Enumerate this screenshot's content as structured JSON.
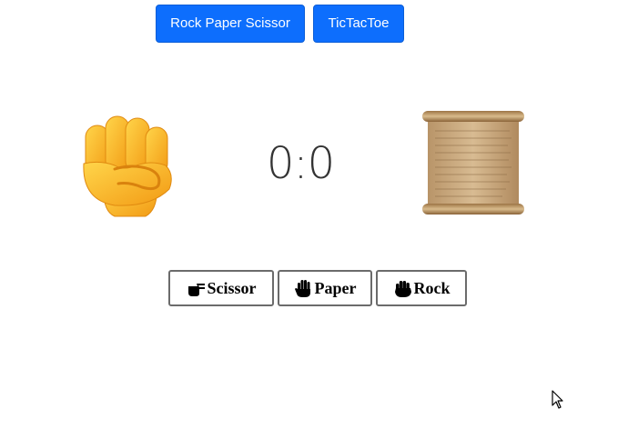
{
  "nav": {
    "rps_label": "Rock Paper Scissor",
    "ttt_label": "TicTacToe"
  },
  "game": {
    "player_choice_icon": "raised-fist-icon",
    "computer_choice_icon": "scroll-icon",
    "score": "0:0"
  },
  "choices": [
    {
      "label": "Scissor",
      "icon": "victory-hand-icon"
    },
    {
      "label": "Paper",
      "icon": "raised-hand-icon"
    },
    {
      "label": "Rock",
      "icon": "raised-back-of-hand-icon"
    }
  ],
  "colors": {
    "primary": "#0d6efd",
    "fist": "#f7b62a",
    "scroll": "#c8a77a"
  }
}
